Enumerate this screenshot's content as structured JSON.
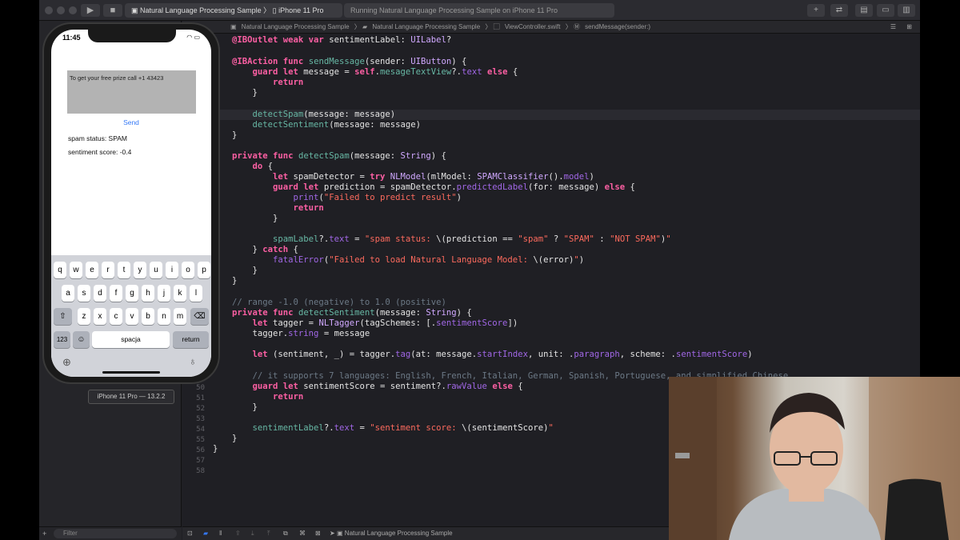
{
  "toolbar": {
    "scheme": "Natural Language Processing Sample",
    "device": "iPhone 11 Pro",
    "status": "Running Natural Language Processing Sample on iPhone 11 Pro"
  },
  "jumpbar": {
    "project": "Natural Language Processing Sample",
    "group": "Natural Language Processing Sample",
    "file": "ViewController.swift",
    "method": "sendMessage(sender:)"
  },
  "simulator": {
    "time": "11:45",
    "message": "To get your free prize call +1 43423",
    "send_label": "Send",
    "spam_status": "spam status: SPAM",
    "sentiment_score": "sentiment score: -0.4",
    "device_label": "iPhone 11 Pro — 13.2.2",
    "keyboard": {
      "row1": [
        "q",
        "w",
        "e",
        "r",
        "t",
        "y",
        "u",
        "i",
        "o",
        "p"
      ],
      "row2": [
        "a",
        "s",
        "d",
        "f",
        "g",
        "h",
        "j",
        "k",
        "l"
      ],
      "row3": [
        "z",
        "x",
        "c",
        "v",
        "b",
        "n",
        "m"
      ],
      "numbers": "123",
      "space": "spacja",
      "return": "return"
    }
  },
  "navigator": {
    "filter_placeholder": "Filter"
  },
  "debugbar": {
    "target": "Natural Language Processing Sample"
  },
  "editor": {
    "line_numbers": [
      "50",
      "51",
      "52",
      "53",
      "54",
      "55",
      "56",
      "57",
      "58"
    ]
  }
}
